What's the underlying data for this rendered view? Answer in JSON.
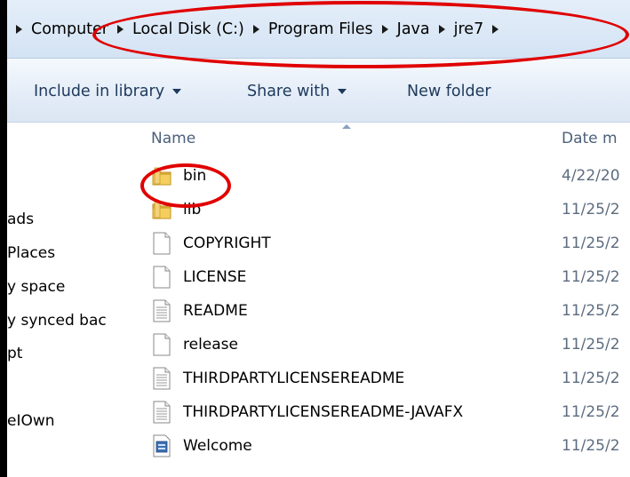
{
  "breadcrumb": [
    "Computer",
    "Local Disk (C:)",
    "Program Files",
    "Java",
    "jre7"
  ],
  "toolbar": {
    "include_label": "Include in library",
    "share_label": "Share with",
    "new_folder_label": "New folder"
  },
  "nav": {
    "items": [
      "ads",
      "Places",
      "y space",
      "y synced bac",
      "pt",
      "eIOwn"
    ]
  },
  "columns": {
    "name": "Name",
    "date": "Date m"
  },
  "files": [
    {
      "name": "bin",
      "date": "4/22/20",
      "icon": "folder-icon"
    },
    {
      "name": "lib",
      "date": "11/25/2",
      "icon": "folder-icon"
    },
    {
      "name": "COPYRIGHT",
      "date": "11/25/2",
      "icon": "file-icon"
    },
    {
      "name": "LICENSE",
      "date": "11/25/2",
      "icon": "file-icon"
    },
    {
      "name": "README",
      "date": "11/25/2",
      "icon": "text-file-icon"
    },
    {
      "name": "release",
      "date": "11/25/2",
      "icon": "file-icon"
    },
    {
      "name": "THIRDPARTYLICENSEREADME",
      "date": "11/25/2",
      "icon": "text-file-icon"
    },
    {
      "name": "THIRDPARTYLICENSEREADME-JAVAFX",
      "date": "11/25/2",
      "icon": "text-file-icon"
    },
    {
      "name": "Welcome",
      "date": "11/25/2",
      "icon": "html-file-icon"
    }
  ],
  "colors": {
    "annotation": "#e00000",
    "toolbar_text": "#1e395b",
    "header_text": "#4c607a"
  }
}
